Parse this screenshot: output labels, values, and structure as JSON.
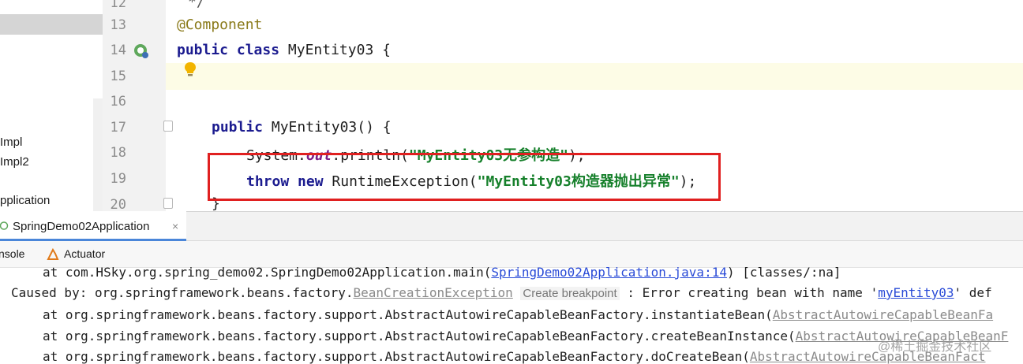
{
  "project_panel": {
    "items": [
      "Impl",
      "Impl2",
      "pplication"
    ]
  },
  "editor": {
    "line_numbers": [
      "12",
      "13",
      "14",
      "15",
      "16",
      "17",
      "18",
      "19",
      "20"
    ],
    "lines": {
      "l12": "*/",
      "l13_annotation": "@Component",
      "l14_kw1": "public",
      "l14_kw2": "class",
      "l14_rest": "MyEntity03 {",
      "l17_kw": "public",
      "l17_rest": "MyEntity03() {",
      "l18_pre": "System.",
      "l18_field": "out",
      "l18_mid": ".println(",
      "l18_str": "\"MyEntity03无参构造\"",
      "l18_end": ");",
      "l19_kw1": "throw",
      "l19_kw2": "new",
      "l19_mid": "RuntimeException(",
      "l19_str": "\"MyEntity03构造器抛出异常\"",
      "l19_end": ");",
      "l20": "}"
    },
    "highlight_color": "#e02020"
  },
  "run_window": {
    "tab_label": "SpringDemo02Application",
    "tab_close": "×",
    "subtabs": {
      "console": "nsole",
      "actuator": "Actuator"
    }
  },
  "console": {
    "line1_pre": "at com.HSky.org.spring_demo02.SpringDemo02Application.main(",
    "line1_link": "SpringDemo02Application.java:14",
    "line1_post": ") [classes/:na]",
    "line2_pre": "Caused by: org.springframework.beans.factory.",
    "line2_link": "BeanCreationException",
    "line2_hint": "Create breakpoint",
    "line2_mid": ": Error creating bean with name '",
    "line2_link2": "myEntity03",
    "line2_post": "' def",
    "line3_pre": "at org.springframework.beans.factory.support.AbstractAutowireCapableBeanFactory.instantiateBean(",
    "line3_link": "AbstractAutowireCapableBeanFa",
    "line4_pre": "at org.springframework.beans.factory.support.AbstractAutowireCapableBeanFactory.createBeanInstance(",
    "line4_link": "AbstractAutowireCapableBeanF",
    "line5_pre": "at org.springframework.beans.factory.support.AbstractAutowireCapableBeanFactory.doCreateBean(",
    "line5_link": "AbstractAutowireCapableBeanFact"
  },
  "watermark": "@稀土掘金技术社区"
}
